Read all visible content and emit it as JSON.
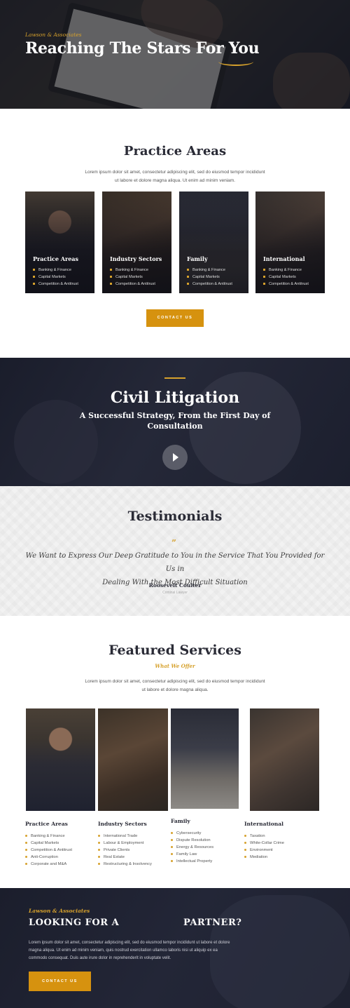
{
  "hero": {
    "kicker": "Lawson & Associates",
    "title": "Reaching The Stars For You"
  },
  "practice": {
    "title": "Practice Areas",
    "intro_line1": "Lorem ipsum dolor sit amet, consectetur adipiscing elit, sed do eiusmod tempor incididunt",
    "intro_line2": "ut labore et dolore magna aliqua. Ut enim ad minim veniam.",
    "cards": [
      {
        "title": "Practice Areas",
        "items": [
          "Banking & Finance",
          "Capital Markets",
          "Competition & Antitrust"
        ],
        "image": "lawyer-portrait"
      },
      {
        "title": "Industry Sectors",
        "items": [
          "Banking & Finance",
          "Capital Markets",
          "Competition & Antitrust"
        ],
        "image": "laptop-handshake"
      },
      {
        "title": "Family",
        "items": [
          "Banking & Finance",
          "Capital Markets",
          "Competition & Antitrust"
        ],
        "image": "suit-signing"
      },
      {
        "title": "International",
        "items": [
          "Banking & Finance",
          "Capital Markets",
          "Competition & Antitrust"
        ],
        "image": "document-signing"
      }
    ],
    "button": "CONTACT US"
  },
  "civil": {
    "title": "Civil Litigation",
    "subtitle_line1": "A Successful Strategy, From the First Day of",
    "subtitle_line2": "Consultation",
    "accent": "#d6a12c"
  },
  "testimonials": {
    "title": "Testimonials",
    "quote_mark": "”",
    "quote_line1": "We Want to Express Our Deep Gratitude to You in the Service That You Provided for Us in",
    "quote_line2": "Dealing With the Most Difficult Situation",
    "author": "Roosevelt Coulter",
    "role": "Criminal Lawyer"
  },
  "featured": {
    "title": "Featured Services",
    "kicker": "What We Offer",
    "intro_line1": "Lorem ipsum dolor sit amet, consectetur adipiscing elit, sed do eiusmod tempor incididunt",
    "intro_line2": "ut labore et dolore magna aliqua.",
    "columns": [
      {
        "title": "Practice Areas",
        "items": [
          "Banking & Finance",
          "Capital Markets",
          "Competition & Antitrust",
          "Anti-Corruption",
          "Corporate and M&A"
        ]
      },
      {
        "title": "Industry Sectors",
        "items": [
          "International Trade",
          "Labour & Employment",
          "Private Clients",
          "Real Estate",
          "Restructuring & Insolvency"
        ]
      },
      {
        "title": "Family",
        "items": [
          "Cybersecurity",
          "Dispute Resolution",
          "Energy & Resources",
          "Family Law",
          "Intellectual Property"
        ]
      },
      {
        "title": "International",
        "items": [
          "Taxation",
          "White-Collar Crime",
          "Environment",
          "Mediation"
        ]
      }
    ]
  },
  "cta": {
    "kicker": "Lawson & Associates",
    "heading_left": "LOOKING FOR A",
    "heading_right": "PARTNER?",
    "para_line1": "Lorem ipsum dolor sit amet, consectetur adipiscing elit, sed do eiusmod tempor incididunt ut labore et dolore",
    "para_line2": "magna aliqua. Ut enim ad minim veniam, quis nostrud exercitation ullamco laboris nisi ut aliquip ex ea",
    "para_line3": "commodo consequat. Duis aute irure dolor in reprehenderit in voluptate velit.",
    "button": "CONTACT US"
  }
}
